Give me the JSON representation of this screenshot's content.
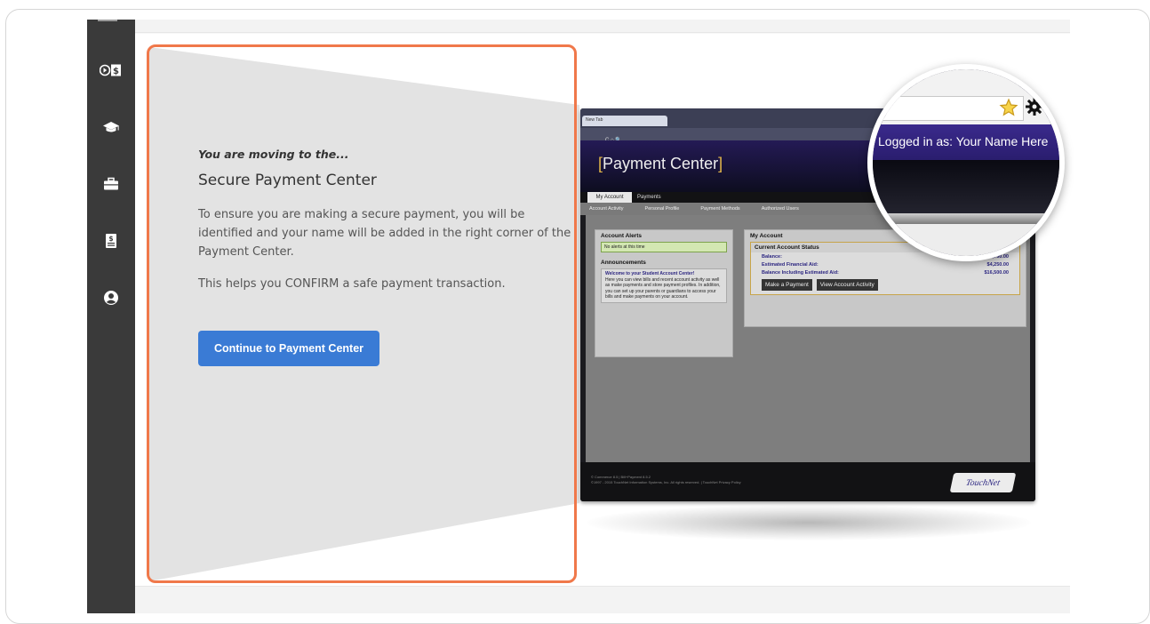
{
  "sidebar": {
    "items": [
      {
        "name": "payment-icon"
      },
      {
        "name": "graduation-cap-icon"
      },
      {
        "name": "briefcase-icon"
      },
      {
        "name": "bill-document-icon"
      },
      {
        "name": "user-profile-icon"
      }
    ]
  },
  "panel": {
    "kicker": "You are moving to the...",
    "title": "Secure Payment Center",
    "body1": "To ensure you are making a secure payment, you will be identified and your name will be added in the right corner of the Payment Center.",
    "body2": "This helps you CONFIRM a safe payment transaction.",
    "cta_label": "Continue to Payment Center"
  },
  "colors": {
    "accent_orange": "#f0784a",
    "button_blue": "#3a7bd5",
    "sidebar_dark": "#3a3a3a"
  },
  "preview": {
    "tab_label": "New Tab",
    "address_text": "C  ⌂  🔍",
    "title_bracket_open": "[",
    "title": "Payment Center",
    "title_bracket_close": "]",
    "tabs": [
      "My Account",
      "Payments"
    ],
    "subnav": [
      "Account Activity",
      "Personal Profile",
      "Payment Methods",
      "Authorized Users"
    ],
    "alerts_heading": "Account Alerts",
    "alerts_text": "No alerts at this time",
    "announcements_heading": "Announcements",
    "announcement_title": "Welcome to your Student Account Center!",
    "announcement_body": "Here you can view bills and recent account activity as well as make payments and store payment profiles. In addition, you can set up your parents or guardians to access your bills and make payments on your account.",
    "my_account_heading": "My Account",
    "status_heading": "Current Account Status",
    "rows": [
      {
        "label": "Balance:",
        "value": "$20,750.00"
      },
      {
        "label": "Estimated Financial Aid:",
        "value": "$4,250.00"
      },
      {
        "label": "Balance Including Estimated Aid:",
        "value": "$16,500.00"
      }
    ],
    "make_payment_label": "Make a Payment",
    "view_activity_label": "View Account Activity",
    "footer_line1": "© Commerce 8.5 | Bill+Payment 8.5.2",
    "footer_line2": "©1997 - 2015 TouchNet Information Systems, Inc. All rights reserved. | TouchNet Privacy Policy",
    "logo_text": "TouchNet",
    "magnified_text": "Logged in as: Your Name Here"
  }
}
